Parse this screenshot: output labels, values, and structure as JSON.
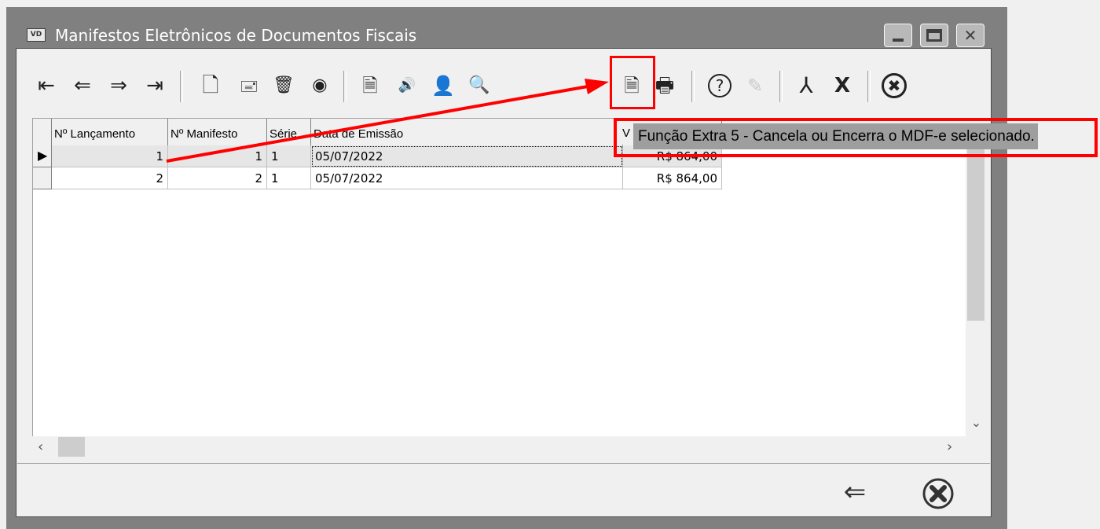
{
  "window": {
    "title": "Manifestos Eletrônicos de Documentos Fiscais",
    "icon_text": "VD"
  },
  "toolbar": {
    "buttons": [
      {
        "name": "first",
        "icon": "first-record-icon",
        "glyph": "⇤"
      },
      {
        "name": "prev",
        "icon": "prev-record-icon",
        "glyph": "⇐"
      },
      {
        "name": "next",
        "icon": "next-record-icon",
        "glyph": "⇒"
      },
      {
        "name": "last",
        "icon": "last-record-icon",
        "glyph": "⇥"
      },
      {
        "name": "new",
        "icon": "new-document-icon",
        "glyph": "🗋"
      },
      {
        "name": "edit",
        "icon": "edit-record-icon",
        "glyph": "🖃"
      },
      {
        "name": "delete",
        "icon": "trash-icon",
        "glyph": "🗑"
      },
      {
        "name": "view",
        "icon": "eye-icon",
        "glyph": "◉"
      },
      {
        "name": "extra1",
        "icon": "document-arrow-icon",
        "glyph": "🗎"
      },
      {
        "name": "extra2",
        "icon": "transmit-icon",
        "glyph": "🔊"
      },
      {
        "name": "extra3",
        "icon": "user-search-icon",
        "glyph": "👤"
      },
      {
        "name": "extra4",
        "icon": "magnifier-icon",
        "glyph": "🔍"
      },
      {
        "name": "extra5",
        "icon": "document-cancel-icon",
        "glyph": "🗎"
      },
      {
        "name": "print",
        "icon": "printer-icon",
        "glyph": "🖶"
      },
      {
        "name": "help",
        "icon": "help-icon",
        "glyph": "?"
      },
      {
        "name": "note",
        "icon": "note-edit-icon",
        "glyph": "✎"
      },
      {
        "name": "pdf",
        "icon": "pdf-icon",
        "glyph": "⅄"
      },
      {
        "name": "excel",
        "icon": "excel-icon",
        "glyph": "X"
      },
      {
        "name": "close",
        "icon": "close-circle-icon",
        "glyph": "✖"
      }
    ]
  },
  "grid": {
    "columns": [
      "Nº Lançamento",
      "Nº Manifesto",
      "Série",
      "Data de Emissão",
      "V"
    ],
    "rows": [
      {
        "lancamento": "1",
        "manifesto": "1",
        "serie": "1",
        "data": "05/07/2022",
        "valor": "R$ 864,00"
      },
      {
        "lancamento": "2",
        "manifesto": "2",
        "serie": "1",
        "data": "05/07/2022",
        "valor": "R$ 864,00"
      }
    ]
  },
  "tooltip": {
    "text": "Função Extra 5 - Cancela ou Encerra o MDF-e selecionado."
  },
  "footer": {
    "back_glyph": "⇐",
    "back_icon": "back-arrow-icon",
    "exit_icon": "exit-circle-icon"
  },
  "colors": {
    "annotation": "#ff0000",
    "titlebar": "#808080",
    "tooltip_bg": "#9e9e9e"
  }
}
